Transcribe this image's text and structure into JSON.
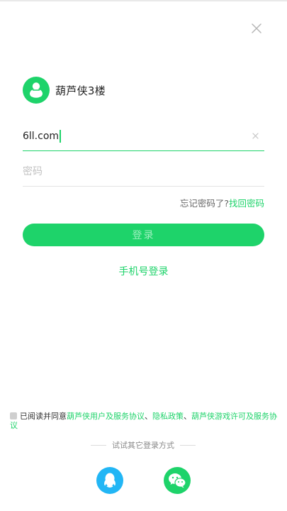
{
  "app": {
    "name": "葫芦侠3楼"
  },
  "colors": {
    "accent": "#1ed36a",
    "qq": "#22b6f5",
    "text": "#222222",
    "muted": "#c2c2c2"
  },
  "icons": {
    "close": "close-icon",
    "logo": "gourd-logo-icon",
    "clear": "clear-icon",
    "qq": "qq-icon",
    "wechat": "wechat-icon"
  },
  "form": {
    "account_value": "6ll.com",
    "password_placeholder": "密码"
  },
  "forgot": {
    "question": "忘记密码了?",
    "link": "找回密码"
  },
  "login_button": "登录",
  "phone_login": "手机号登录",
  "agreement": {
    "prefix": "已阅读并同意",
    "link_user_service": "葫芦侠用户及服务协议",
    "sep1": "、",
    "link_privacy": "隐私政策",
    "sep2": "、",
    "link_game_license_part1": "葫芦侠游戏许可及服务协",
    "link_game_license_part2": "议"
  },
  "other_login": {
    "label": "试试其它登录方式"
  }
}
